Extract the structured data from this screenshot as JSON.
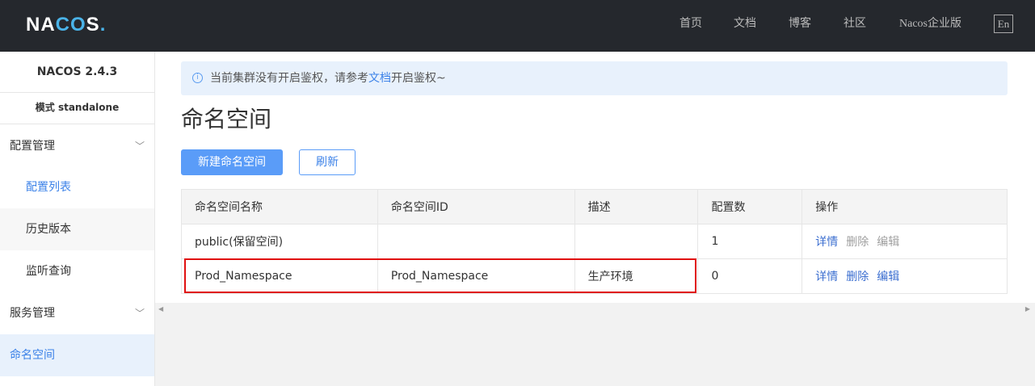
{
  "header": {
    "logo": "NACOS.",
    "nav": [
      "首页",
      "文档",
      "博客",
      "社区",
      "Nacos企业版"
    ],
    "lang": "En"
  },
  "sidebar": {
    "version": "NACOS 2.4.3",
    "mode": "模式 standalone",
    "items": [
      {
        "label": "配置管理",
        "type": "group"
      },
      {
        "label": "配置列表",
        "type": "sub",
        "active": true
      },
      {
        "label": "历史版本",
        "type": "sub"
      },
      {
        "label": "监听查询",
        "type": "sub"
      },
      {
        "label": "服务管理",
        "type": "group"
      },
      {
        "label": "命名空间",
        "type": "group",
        "selected": true
      }
    ]
  },
  "alert": {
    "before": "当前集群没有开启鉴权，请参考",
    "link": "文档",
    "after": "开启鉴权~"
  },
  "page": {
    "title": "命名空间",
    "new_button": "新建命名空间",
    "refresh_button": "刷新"
  },
  "table": {
    "headers": [
      "命名空间名称",
      "命名空间ID",
      "描述",
      "配置数",
      "操作"
    ],
    "rows": [
      {
        "name": "public(保留空间)",
        "id": "",
        "desc": "",
        "count": "1",
        "actions": [
          "详情",
          "删除",
          "编辑"
        ],
        "actions_enabled": [
          true,
          false,
          false
        ]
      },
      {
        "name": "Prod_Namespace",
        "id": "Prod_Namespace",
        "desc": "生产环境",
        "count": "0",
        "actions": [
          "详情",
          "删除",
          "编辑"
        ],
        "actions_enabled": [
          true,
          true,
          true
        ],
        "highlighted": true
      }
    ]
  },
  "colors": {
    "header_bg": "#25282d",
    "primary": "#5a9cf8",
    "highlight_border": "#e01010"
  }
}
